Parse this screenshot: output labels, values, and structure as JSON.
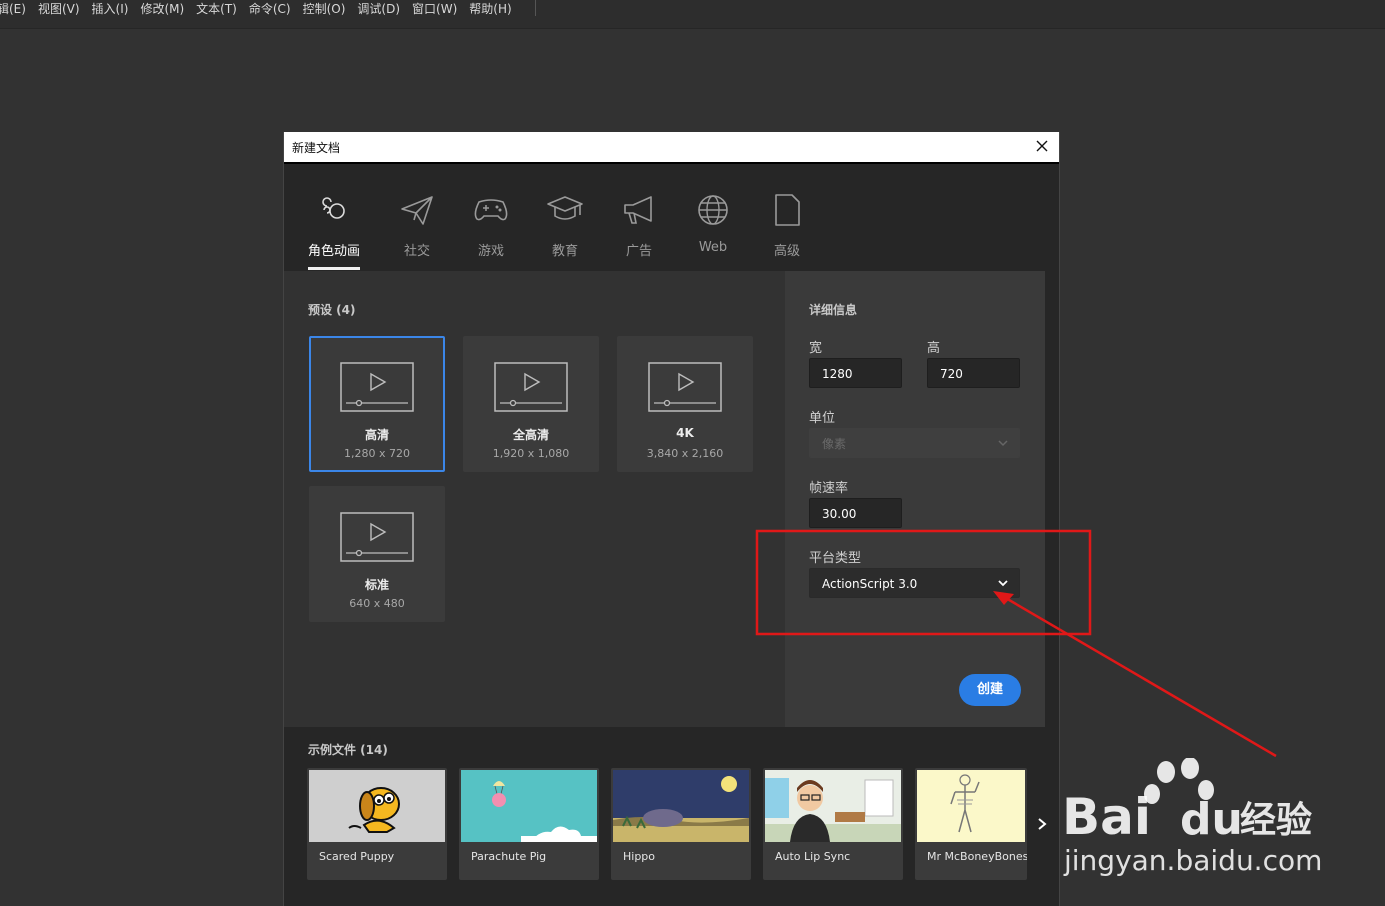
{
  "menu": {
    "items": [
      "辑(E)",
      "视图(V)",
      "插入(I)",
      "修改(M)",
      "文本(T)",
      "命令(C)",
      "控制(O)",
      "调试(D)",
      "窗口(W)",
      "帮助(H)"
    ]
  },
  "dialog": {
    "title": "新建文档",
    "close_icon": "close-icon",
    "tabs": [
      {
        "label": "角色动画",
        "icon": "character-animation-icon",
        "active": true
      },
      {
        "label": "社交",
        "icon": "paper-plane-icon",
        "active": false
      },
      {
        "label": "游戏",
        "icon": "gamepad-icon",
        "active": false
      },
      {
        "label": "教育",
        "icon": "graduation-cap-icon",
        "active": false
      },
      {
        "label": "广告",
        "icon": "megaphone-icon",
        "active": false
      },
      {
        "label": "Web",
        "icon": "globe-icon",
        "active": false
      },
      {
        "label": "高级",
        "icon": "document-icon",
        "active": false
      }
    ],
    "presets": {
      "label": "预设 (4)",
      "items": [
        {
          "name": "高清",
          "size": "1,280 x 720",
          "selected": true
        },
        {
          "name": "全高清",
          "size": "1,920 x 1,080",
          "selected": false
        },
        {
          "name": "4K",
          "size": "3,840 x 2,160",
          "selected": false
        },
        {
          "name": "标准",
          "size": "640 x 480",
          "selected": false
        }
      ]
    },
    "details": {
      "label": "详细信息",
      "width_label": "宽",
      "width_value": "1280",
      "height_label": "高",
      "height_value": "720",
      "unit_label": "单位",
      "unit_value": "像素",
      "fps_label": "帧速率",
      "fps_value": "30.00",
      "platform_label": "平台类型",
      "platform_value": "ActionScript 3.0",
      "create_label": "创建"
    },
    "samples": {
      "label": "示例文件 (14)",
      "items": [
        {
          "name": "Scared Puppy"
        },
        {
          "name": "Parachute Pig"
        },
        {
          "name": "Hippo"
        },
        {
          "name": "Auto Lip Sync"
        },
        {
          "name": "Mr McBoneyBones"
        }
      ]
    }
  },
  "watermark": {
    "brand": "Bai",
    "brand2": "du",
    "cn": "经验",
    "url": "jingyan.baidu.com"
  },
  "colors": {
    "accent": "#2a7de4",
    "annotation": "#e01818",
    "background": "#323232"
  }
}
